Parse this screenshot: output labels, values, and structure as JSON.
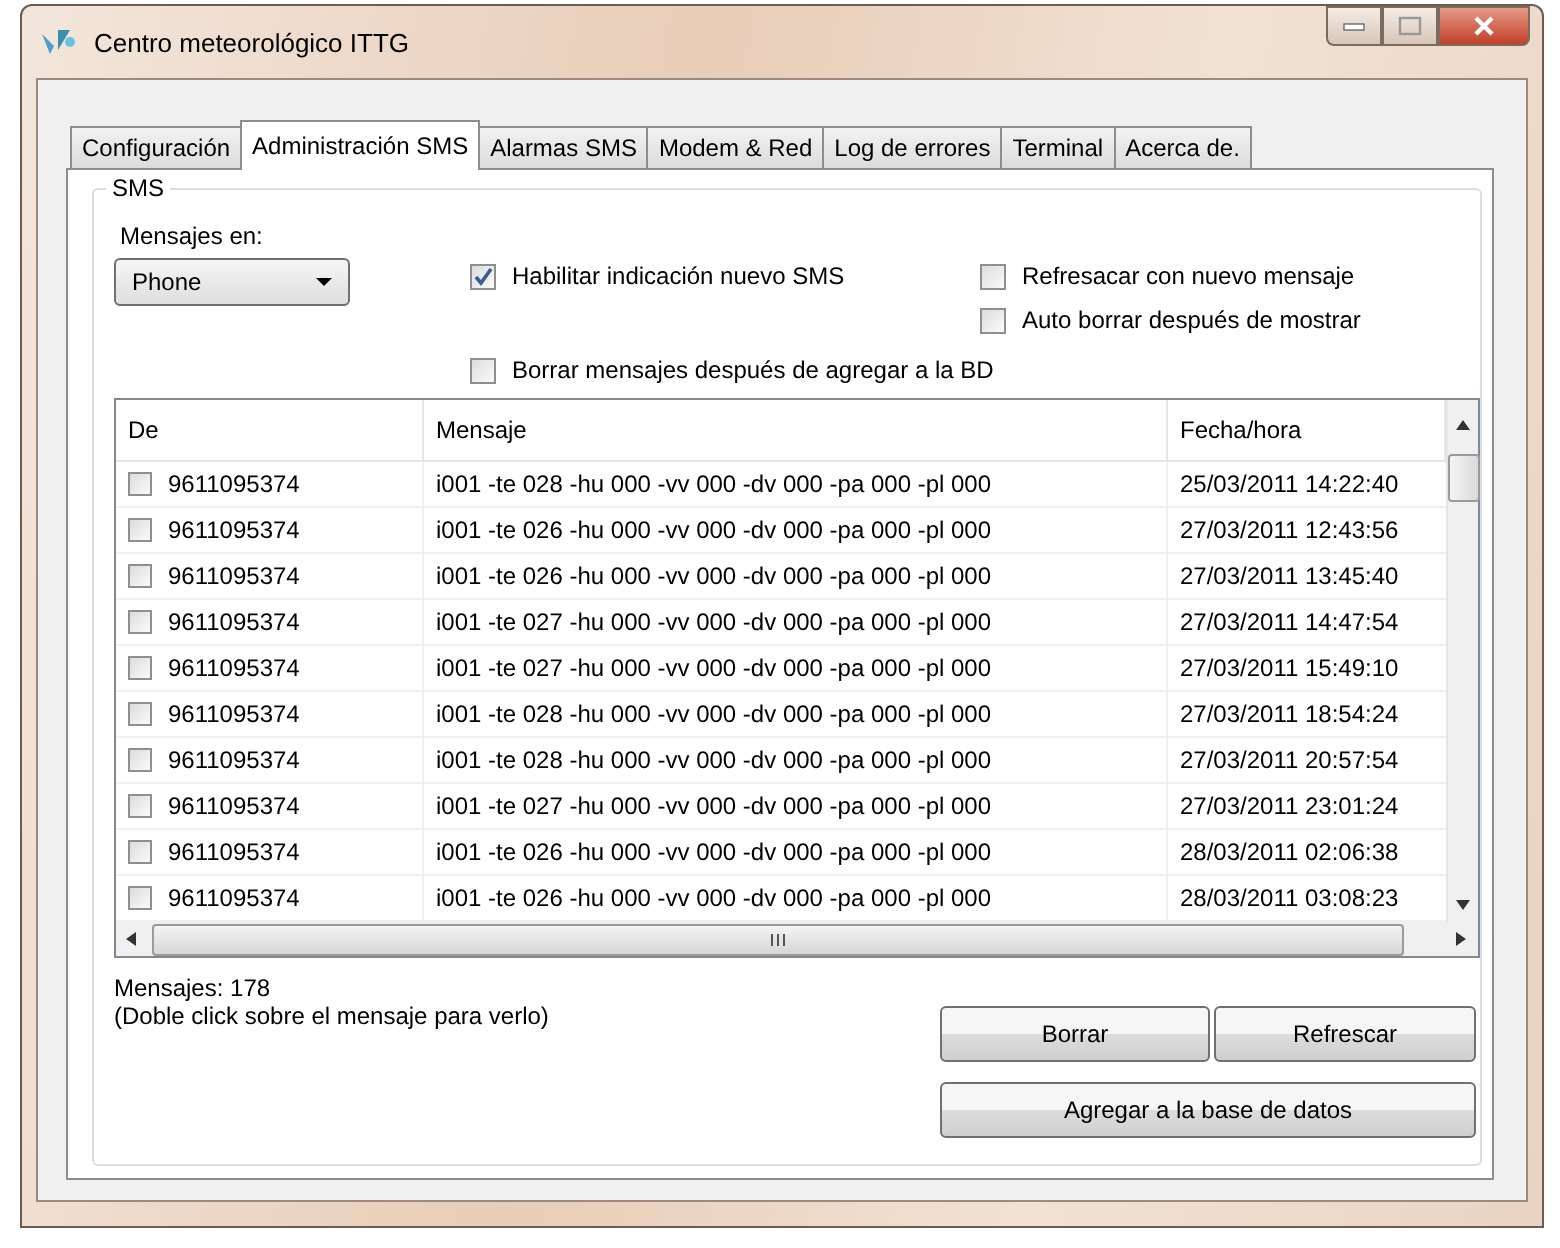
{
  "window": {
    "title": "Centro meteorológico ITTG"
  },
  "tabs": [
    {
      "label": "Configuración",
      "selected": false
    },
    {
      "label": "Administración SMS",
      "selected": true
    },
    {
      "label": "Alarmas SMS",
      "selected": false
    },
    {
      "label": "Modem & Red",
      "selected": false
    },
    {
      "label": "Log de errores",
      "selected": false
    },
    {
      "label": "Terminal",
      "selected": false
    },
    {
      "label": "Acerca de.",
      "selected": false
    }
  ],
  "group": {
    "title": "SMS"
  },
  "messages_in": {
    "label": "Mensajes en:",
    "value": "Phone"
  },
  "options": [
    {
      "label": "Habilitar indicación nuevo SMS",
      "checked": true
    },
    {
      "label": "Refresacar con nuevo mensaje",
      "checked": false
    },
    {
      "label": "Auto borrar después de mostrar",
      "checked": false
    },
    {
      "label": "Borrar mensajes después de agregar a la BD",
      "checked": false
    }
  ],
  "table": {
    "columns": [
      "De",
      "Mensaje",
      "Fecha/hora"
    ],
    "rows": [
      {
        "checked": false,
        "cells": [
          "9611095374",
          "i001 -te 028 -hu 000 -vv 000 -dv 000 -pa 000 -pl 000",
          "25/03/2011 14:22:40"
        ]
      },
      {
        "checked": false,
        "cells": [
          "9611095374",
          "i001 -te 026 -hu 000 -vv 000 -dv 000 -pa 000 -pl 000",
          "27/03/2011 12:43:56"
        ]
      },
      {
        "checked": false,
        "cells": [
          "9611095374",
          "i001 -te 026 -hu 000 -vv 000 -dv 000 -pa 000 -pl 000",
          "27/03/2011 13:45:40"
        ]
      },
      {
        "checked": false,
        "cells": [
          "9611095374",
          "i001 -te 027 -hu 000 -vv 000 -dv 000 -pa 000 -pl 000",
          "27/03/2011 14:47:54"
        ]
      },
      {
        "checked": false,
        "cells": [
          "9611095374",
          "i001 -te 027 -hu 000 -vv 000 -dv 000 -pa 000 -pl 000",
          "27/03/2011 15:49:10"
        ]
      },
      {
        "checked": false,
        "cells": [
          "9611095374",
          "i001 -te 028 -hu 000 -vv 000 -dv 000 -pa 000 -pl 000",
          "27/03/2011 18:54:24"
        ]
      },
      {
        "checked": false,
        "cells": [
          "9611095374",
          "i001 -te 028 -hu 000 -vv 000 -dv 000 -pa 000 -pl 000",
          "27/03/2011 20:57:54"
        ]
      },
      {
        "checked": false,
        "cells": [
          "9611095374",
          "i001 -te 027 -hu 000 -vv 000 -dv 000 -pa 000 -pl 000",
          "27/03/2011 23:01:24"
        ]
      },
      {
        "checked": false,
        "cells": [
          "9611095374",
          "i001 -te 026 -hu 000 -vv 000 -dv 000 -pa 000 -pl 000",
          "28/03/2011 02:06:38"
        ]
      },
      {
        "checked": false,
        "cells": [
          "9611095374",
          "i001 -te 026 -hu 000 -vv 000 -dv 000 -pa 000 -pl 000",
          "28/03/2011 03:08:23"
        ]
      }
    ]
  },
  "status": {
    "count": "Mensajes: 178",
    "hint": "(Doble click sobre el mensaje para verlo)"
  },
  "buttons": [
    "Borrar",
    "Refrescar",
    "Agregar a la base de datos"
  ]
}
